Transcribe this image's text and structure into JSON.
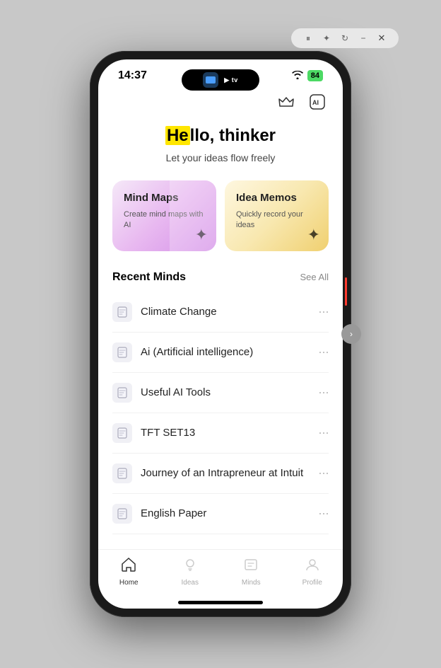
{
  "browser": {
    "icons": [
      "pause-icon",
      "star-icon",
      "refresh-icon",
      "minimize-icon",
      "close-icon"
    ]
  },
  "status_bar": {
    "time": "14:37",
    "wifi": "📶",
    "battery": "84"
  },
  "dynamic_island": {
    "tv_label": "▶ tv"
  },
  "top_icons": {
    "crown_icon": "♛",
    "ai_icon": "Ai"
  },
  "hero": {
    "greeting_prefix": "",
    "greeting_highlight": "He",
    "greeting_rest": "llo, thinker",
    "title": "Hello, thinker",
    "subtitle": "Let your ideas flow freely"
  },
  "cards": [
    {
      "id": "mind-maps",
      "title": "Mind Maps",
      "subtitle": "Create mind maps with AI",
      "decoration": "✦"
    },
    {
      "id": "idea-memos",
      "title": "Idea Memos",
      "subtitle": "Quickly record your ideas",
      "decoration": "✦"
    }
  ],
  "recent_section": {
    "title": "Recent Minds",
    "see_all": "See All"
  },
  "recent_items": [
    {
      "label": "Climate Change"
    },
    {
      "label": "Ai (Artificial intelligence)"
    },
    {
      "label": "Useful AI Tools"
    },
    {
      "label": "TFT SET13"
    },
    {
      "label": "Journey of an Intrapreneur at Intuit"
    },
    {
      "label": "English Paper"
    }
  ],
  "nav": [
    {
      "id": "home",
      "label": "Home",
      "icon": "⌂",
      "active": true
    },
    {
      "id": "ideas",
      "label": "Ideas",
      "icon": "◯",
      "active": false
    },
    {
      "id": "minds",
      "label": "Minds",
      "icon": "▭",
      "active": false
    },
    {
      "id": "profile",
      "label": "Profile",
      "icon": "◻",
      "active": false
    }
  ]
}
